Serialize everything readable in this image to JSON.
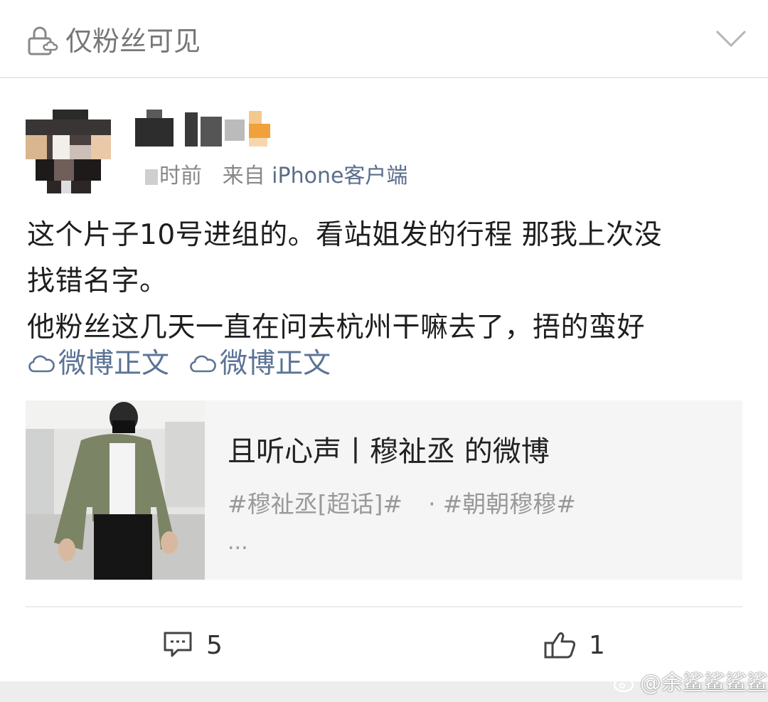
{
  "visibility": {
    "icon": "lock-cloud-icon",
    "label": "仅粉丝可见"
  },
  "post": {
    "meta_time": "\u0000\u0000小时前",
    "meta_prefix": "时前",
    "meta_from": "来自",
    "meta_source": "iPhone客户端",
    "lines": [
      "这个片子10号进组的。看站姐发的行程 那我上次没",
      "找错名字。",
      "他粉丝这几天一直在问去杭州干嘛去了，捂的蛮好"
    ],
    "links": [
      "微博正文",
      "微博正文"
    ]
  },
  "card": {
    "title": "且听心声丨穆祉丞 的微博",
    "tag1": "#穆祉丞[超话]#",
    "dot": "·",
    "tag2": "#朝朝穆穆#",
    "more": "..."
  },
  "actions": {
    "comment_count": "5",
    "like_count": "1"
  },
  "watermark": "@余鲨鲨鲨鲨",
  "colors": {
    "link": "#5b7396",
    "muted": "#888888"
  }
}
